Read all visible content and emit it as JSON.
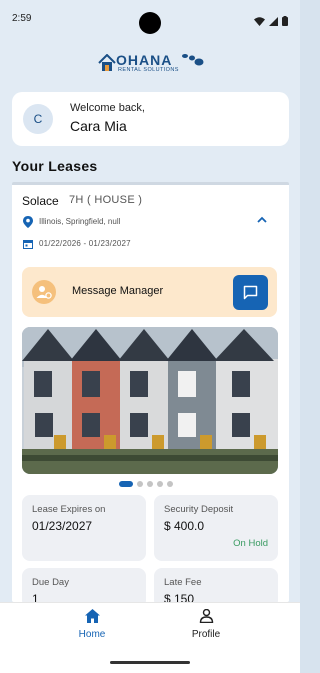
{
  "status": {
    "time": "2:59"
  },
  "brand": {
    "name": "OHANA",
    "subtitle": "RENTAL SOLUTIONS"
  },
  "welcome": {
    "avatar_letter": "C",
    "label": "Welcome back,",
    "name": "Cara Mia"
  },
  "leases_title": "Your Leases",
  "lease": {
    "property_name": "Solace",
    "unit": "7H ( HOUSE )",
    "address": "Illinois, Springfield, null",
    "dates": "01/22/2026 - 01/23/2027",
    "message_label": "Message Manager",
    "carousel": {
      "count": 5,
      "active": 0
    },
    "stats": {
      "lease_expires_label": "Lease Expires on",
      "lease_expires_value": "01/23/2027",
      "deposit_label": "Security Deposit",
      "deposit_value": "$ 400.0",
      "deposit_status": "On Hold",
      "due_day_label": "Due Day",
      "due_day_value": "1",
      "late_fee_label": "Late Fee",
      "late_fee_value": "$ 150"
    }
  },
  "nav": {
    "home": "Home",
    "profile": "Profile"
  },
  "colors": {
    "accent": "#1664b4",
    "brand": "#1a4f86",
    "message_bg": "#fde8cc",
    "success": "#3a9b62"
  },
  "icons": [
    "location-pin-icon",
    "calendar-icon",
    "chevron-up-icon",
    "manager-icon",
    "chat-icon",
    "home-icon",
    "person-icon"
  ]
}
